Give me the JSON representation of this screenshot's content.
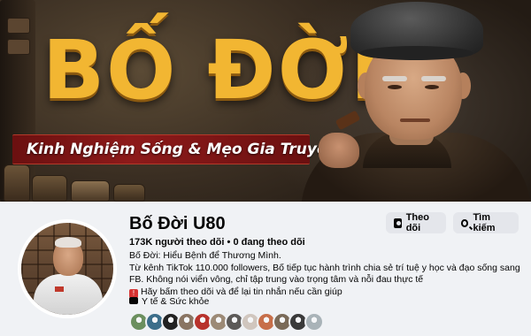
{
  "cover": {
    "title": "BỐ ĐỜI",
    "subtitle": "Kinh Nghiệm Sống & Mẹo Gia Truyền 3 Đời"
  },
  "page": {
    "name": "Bố Đời U80",
    "followers": "173K người theo dõi",
    "separator": " • ",
    "following": "0 đang theo dõi",
    "bio_lines": [
      "Bố Đời: Hiểu Bệnh để Thương Mình.",
      "Từ kênh TikTok 110.000 followers, Bố tiếp tục hành trình chia sẻ trí tuệ y học và đạo sống sang",
      "FB. Không nói viển vông, chỉ tập trung vào trọng tâm và nỗi đau thực tế",
      "Hãy bấm theo dõi và để lại tin nhắn nếu cần giúp"
    ],
    "category": "Y tế & Sức khỏe"
  },
  "actions": {
    "follow_label": "Theo dõi",
    "search_label": "Tìm kiếm"
  },
  "icons": {
    "follow": "follow-icon",
    "search": "search-icon",
    "category": "category-icon",
    "pin": "sos-icon"
  },
  "colors": {
    "title_gold": "#f2b632",
    "subtitle_bar": "#8d1a1a",
    "button_bg": "#e4e6eb",
    "page_bg": "#f0f2f5"
  },
  "follower_avatar_colors": [
    "#6b8f5e",
    "#3c6e8a",
    "#222222",
    "#8a7563",
    "#b8322c",
    "#9c8a76",
    "#5c5a58",
    "#d0c6be",
    "#c76f4a",
    "#7a6a58",
    "#3a3a3a",
    "#a9b3b8"
  ]
}
